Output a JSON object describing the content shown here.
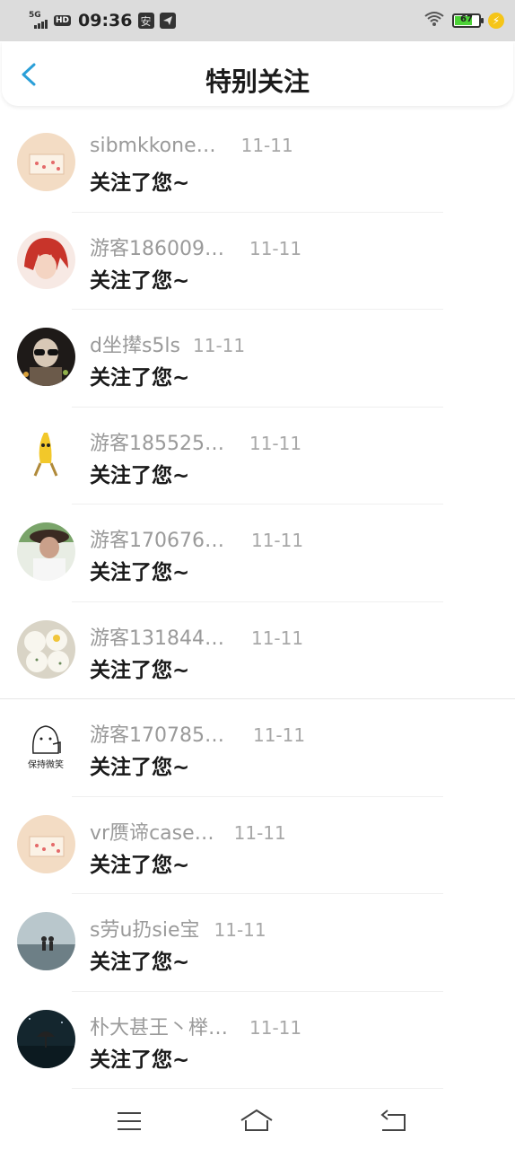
{
  "status_bar": {
    "network": "5G",
    "hd": "HD",
    "time": "09:36",
    "app_icon_1": "安",
    "battery_level": "67",
    "icons": [
      "signal-icon",
      "hd-icon",
      "app-icon",
      "telegram-icon",
      "wifi-icon",
      "battery-icon",
      "charging-icon"
    ]
  },
  "header": {
    "title": "特别关注",
    "back_icon": "chevron-left-icon",
    "accent": "#2a9fd8"
  },
  "items": [
    {
      "name": "sibmkkone…",
      "date": "11-11",
      "message": "关注了您~",
      "avatar": "cake-avatar"
    },
    {
      "name": "游客186009…",
      "date": "11-11",
      "message": "关注了您~",
      "avatar": "anime-avatar"
    },
    {
      "name": "d坐撵s5ls",
      "date": "11-11",
      "message": "关注了您~",
      "avatar": "sunglasses-avatar"
    },
    {
      "name": "游客185525…",
      "date": "11-11",
      "message": "关注了您~",
      "avatar": "banana-avatar"
    },
    {
      "name": "游客170676…",
      "date": "11-11",
      "message": "关注了您~",
      "avatar": "hat-person-avatar"
    },
    {
      "name": "游客131844…",
      "date": "11-11",
      "message": "关注了您~",
      "avatar": "buns-avatar"
    },
    {
      "name": "游客170785…",
      "date": "11-11",
      "message": "关注了您~",
      "avatar": "sketch-avatar",
      "avatar_caption": "保持微笑"
    },
    {
      "name": "vr赝谛case…",
      "date": "11-11",
      "message": "关注了您~",
      "avatar": "cake-avatar"
    },
    {
      "name": "s劳u扔sie宝",
      "date": "11-11",
      "message": "关注了您~",
      "avatar": "sea-couple-avatar"
    },
    {
      "name": "朴大甚王丶榉…",
      "date": "11-11",
      "message": "关注了您~",
      "avatar": "night-umbrella-avatar"
    }
  ],
  "nav_bar": {
    "icons": [
      "menu-icon",
      "home-icon",
      "back-icon"
    ]
  }
}
